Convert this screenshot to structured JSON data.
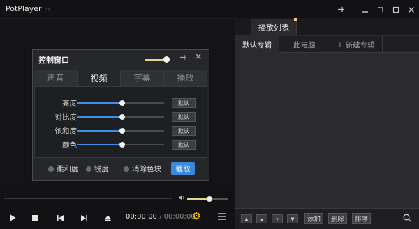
{
  "app": {
    "title": "PotPlayer"
  },
  "control_window": {
    "title": "控制窗口",
    "volume_level": 0.85,
    "tabs": [
      {
        "label": "声音",
        "active": false
      },
      {
        "label": "视频",
        "active": true
      },
      {
        "label": "字幕",
        "active": false
      },
      {
        "label": "播放",
        "active": false
      }
    ],
    "sliders": [
      {
        "label": "亮度",
        "value": 0.52,
        "reset_label": "默认"
      },
      {
        "label": "对比度",
        "value": 0.52,
        "reset_label": "默认"
      },
      {
        "label": "饱和度",
        "value": 0.52,
        "reset_label": "默认"
      },
      {
        "label": "颜色",
        "value": 0.52,
        "reset_label": "默认"
      }
    ],
    "options": [
      {
        "label": "柔和度"
      },
      {
        "label": "锐度"
      },
      {
        "label": "消除色块"
      }
    ],
    "capture_label": "截取"
  },
  "playback": {
    "time_current": "00:00:00",
    "time_separator": "/",
    "time_total": "00:00:00",
    "volume_level": 0.55
  },
  "playlist": {
    "tab_label": "播放列表",
    "subtabs": [
      {
        "label": "默认专辑",
        "active": true
      },
      {
        "label": "此电脑",
        "active": false
      },
      {
        "label": "+ 新建专辑",
        "active": false
      }
    ],
    "footer": {
      "add_label": "添加",
      "delete_label": "删除",
      "sort_label": "排序"
    }
  },
  "colors": {
    "accent_blue": "#3a87e0",
    "accent_gold": "#e8d28a",
    "gear": "#f0c000"
  }
}
